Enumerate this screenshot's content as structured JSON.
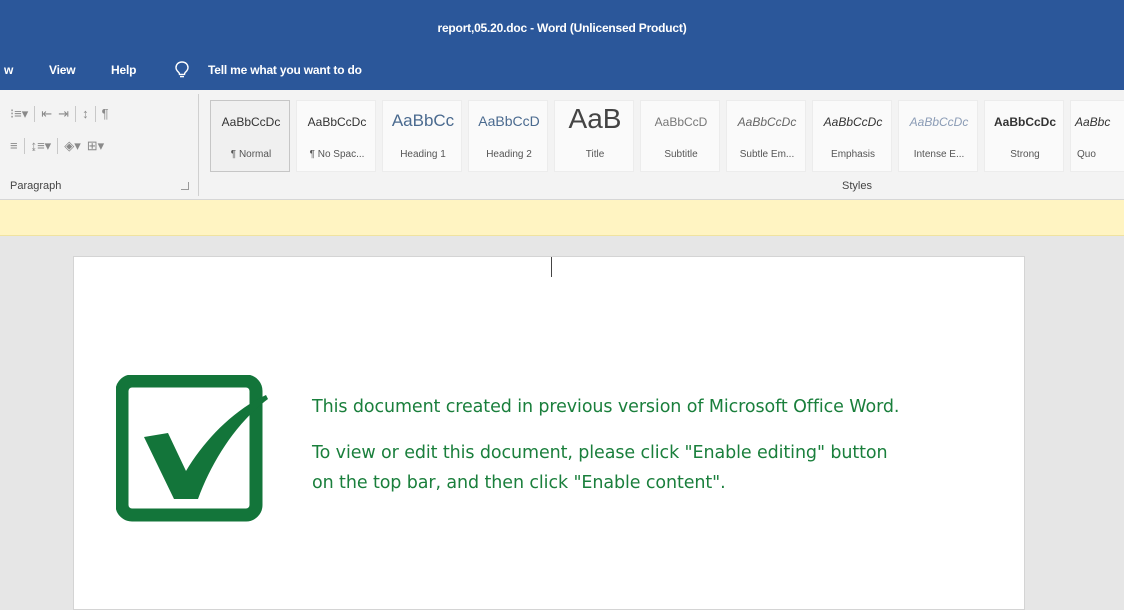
{
  "window": {
    "title": "report,05.20.doc  -  Word (Unlicensed Product)"
  },
  "menu": {
    "partial_tab": "w",
    "view": "View",
    "help": "Help",
    "tell_me": "Tell me what you want to do"
  },
  "ribbon": {
    "paragraph_label": "Paragraph",
    "styles_label": "Styles",
    "styles": [
      {
        "sample": "AaBbCcDc",
        "name": "¶ Normal"
      },
      {
        "sample": "AaBbCcDc",
        "name": "¶ No Spac..."
      },
      {
        "sample": "AaBbCc",
        "name": "Heading 1"
      },
      {
        "sample": "AaBbCcD",
        "name": "Heading 2"
      },
      {
        "sample": "AaB",
        "name": "Title"
      },
      {
        "sample": "AaBbCcD",
        "name": "Subtitle"
      },
      {
        "sample": "AaBbCcDc",
        "name": "Subtle Em..."
      },
      {
        "sample": "AaBbCcDc",
        "name": "Emphasis"
      },
      {
        "sample": "AaBbCcDc",
        "name": "Intense E..."
      },
      {
        "sample": "AaBbCcDc",
        "name": "Strong"
      },
      {
        "sample": "AaBbc",
        "name": "Quo"
      }
    ]
  },
  "document": {
    "line1": "This document created in previous version of Microsoft Office Word.",
    "line2": "To view or edit this document, please click \"Enable editing\" button",
    "line3": "on the top bar, and then click \"Enable content\"."
  },
  "colors": {
    "titlebar": "#2b579a",
    "message_bar": "#fff4c2",
    "logo_green": "#13753a",
    "text_green": "#1a7f3c"
  },
  "icons": [
    "tell-me-lightbulb-icon",
    "green-checkmark-icon"
  ]
}
